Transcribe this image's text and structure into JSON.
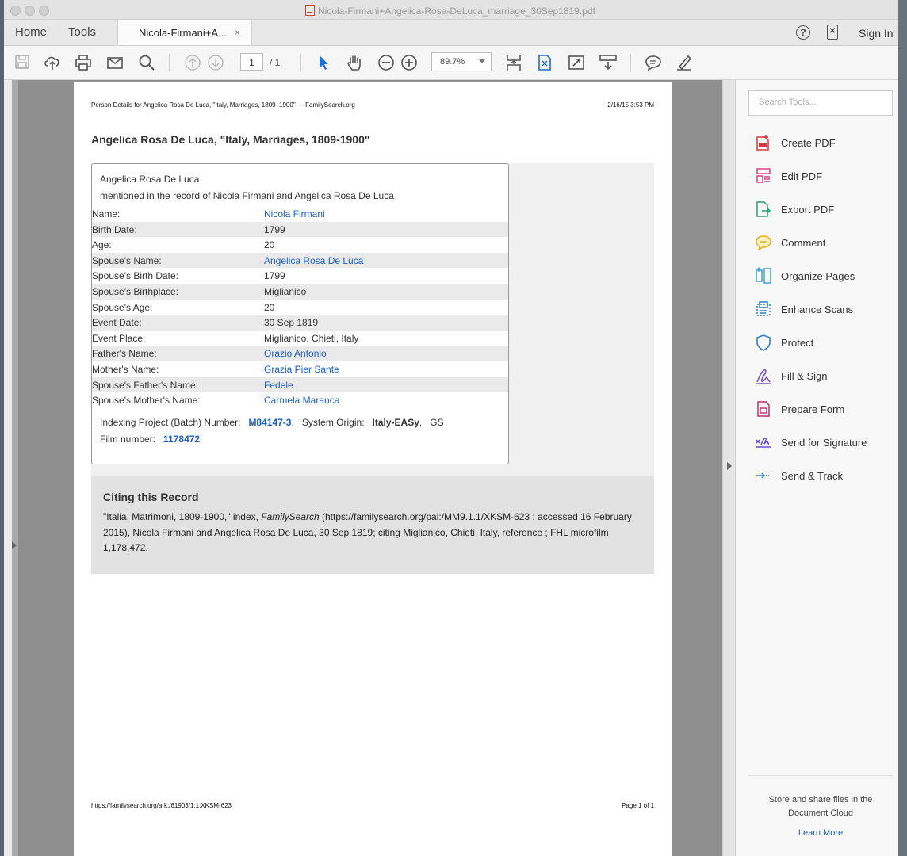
{
  "window": {
    "title": "Nicola-Firmani+Angelica-Rosa-DeLuca_marriage_30Sep1819.pdf"
  },
  "tabs": {
    "home": "Home",
    "tools": "Tools",
    "doc": "Nicola-Firmani+A...",
    "close": "×"
  },
  "header_right": {
    "help_glyph": "?",
    "mobile_glyph": "✕",
    "signin": "Sign In"
  },
  "toolbar": {
    "page_current": "1",
    "page_total": "/ 1",
    "zoom": "89.7%"
  },
  "page": {
    "header_left": "Person Details for Angelica Rosa De Luca, \"Italy, Marriages, 1809–1900\" — FamilySearch.org",
    "header_right": "2/16/15 3:53 PM",
    "title": "Angelica Rosa De Luca, \"Italy, Marriages, 1809-1900\"",
    "card": {
      "name": "Angelica Rosa De Luca",
      "subtitle": "mentioned in the record of Nicola Firmani and Angelica Rosa De Luca",
      "rows": [
        {
          "label": "Name:",
          "value": "Nicola Firmani"
        },
        {
          "label": "Birth Date:",
          "value": "1799"
        },
        {
          "label": "Age:",
          "value": "20"
        },
        {
          "label": "Spouse's Name:",
          "value": "Angelica Rosa De Luca"
        },
        {
          "label": "Spouse's Birth Date:",
          "value": "1799"
        },
        {
          "label": "Spouse's Birthplace:",
          "value": "Miglianico"
        },
        {
          "label": "Spouse's Age:",
          "value": "20"
        },
        {
          "label": "Event Date:",
          "value": "30 Sep 1819"
        },
        {
          "label": "Event Place:",
          "value": "Miglianico, Chieti, Italy"
        },
        {
          "label": "Father's Name:",
          "value": "Orazio Antonio"
        },
        {
          "label": "Mother's Name:",
          "value": "Grazia Pier Sante"
        },
        {
          "label": "Spouse's Father's Name:",
          "value": "Fedele"
        },
        {
          "label": "Spouse's Mother's Name:",
          "value": "Carmela Maranca"
        }
      ],
      "indexing_label": "Indexing Project (Batch) Number:",
      "indexing_value": "M84147-3",
      "comma": ",",
      "system_origin_label": "System Origin:",
      "system_origin_value": "Italy-EASy",
      "gs": "GS",
      "film_label": "Film number:",
      "film_value": "1178472"
    },
    "cite": {
      "heading": "Citing this Record",
      "text_a": "\"Italia, Matrimoni, 1809-1900,\" index, ",
      "text_italic": "FamilySearch",
      "text_b": " (https://familysearch.org/pal:/MM9.1.1/XKSM-623 : accessed 16 February 2015), Nicola Firmani and Angelica Rosa De Luca, 30 Sep 1819; citing Miglianico, Chieti, Italy, reference ; FHL microfilm 1,178,472."
    },
    "footer_url": "https://familysearch.org/ark:/61903/1:1:XKSM-623",
    "footer_page": "Page 1 of 1"
  },
  "right_panel": {
    "search_placeholder": "Search Tools...",
    "tools": [
      {
        "label": "Create PDF",
        "icon": "create-pdf-icon",
        "color": "#d7373f"
      },
      {
        "label": "Edit PDF",
        "icon": "edit-pdf-icon",
        "color": "#d8408c"
      },
      {
        "label": "Export PDF",
        "icon": "export-pdf-icon",
        "color": "#2d9d78"
      },
      {
        "label": "Comment",
        "icon": "comment-icon",
        "color": "#e8b21c"
      },
      {
        "label": "Organize Pages",
        "icon": "organize-pages-icon",
        "color": "#3aa3d8"
      },
      {
        "label": "Enhance Scans",
        "icon": "enhance-scans-icon",
        "color": "#2a7ed0"
      },
      {
        "label": "Protect",
        "icon": "protect-icon",
        "color": "#2a7ed0"
      },
      {
        "label": "Fill & Sign",
        "icon": "fill-sign-icon",
        "color": "#7c54c4"
      },
      {
        "label": "Prepare Form",
        "icon": "prepare-form-icon",
        "color": "#c0306b"
      },
      {
        "label": "Send for Signature",
        "icon": "send-signature-icon",
        "color": "#6a4bd0"
      },
      {
        "label": "Send & Track",
        "icon": "send-track-icon",
        "color": "#2a7ed0"
      }
    ],
    "store_text": "Store and share files in the Document Cloud",
    "learn_more": "Learn More"
  }
}
